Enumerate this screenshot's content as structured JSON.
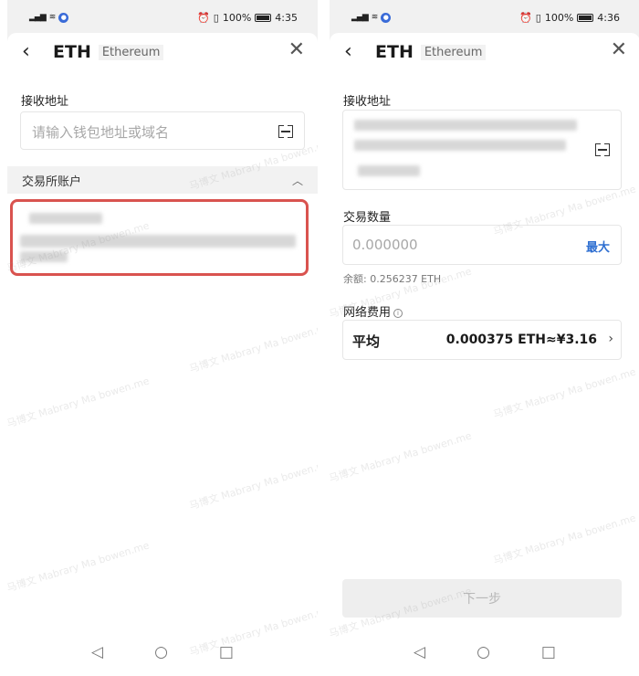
{
  "left": {
    "status": {
      "time": "4:35",
      "battery": "100%"
    },
    "header": {
      "coin": "ETH",
      "coin_name": "Ethereum"
    },
    "address": {
      "label": "接收地址",
      "placeholder": "请输入钱包地址或域名"
    },
    "exchange_section": {
      "label": "交易所账户"
    }
  },
  "right": {
    "status": {
      "time": "4:36",
      "battery": "100%"
    },
    "header": {
      "coin": "ETH",
      "coin_name": "Ethereum"
    },
    "address": {
      "label": "接收地址"
    },
    "amount": {
      "label": "交易数量",
      "placeholder": "0.000000",
      "max_label": "最大",
      "balance": "余额: 0.256237 ETH"
    },
    "fee": {
      "label": "网络费用",
      "name": "平均",
      "value": "0.000375 ETH≈¥3.16"
    },
    "next_button": "下一步"
  },
  "icons": {
    "back": "back-arrow-icon",
    "close": "close-icon",
    "scan": "scan-icon",
    "collapse": "chevron-up-icon",
    "fee_detail": "chevron-right-icon",
    "info": "info-icon"
  },
  "colors": {
    "accent": "#2f6fd1",
    "highlight": "#d9534f"
  },
  "watermark": "马博文 Mabrary Ma bowen.me"
}
